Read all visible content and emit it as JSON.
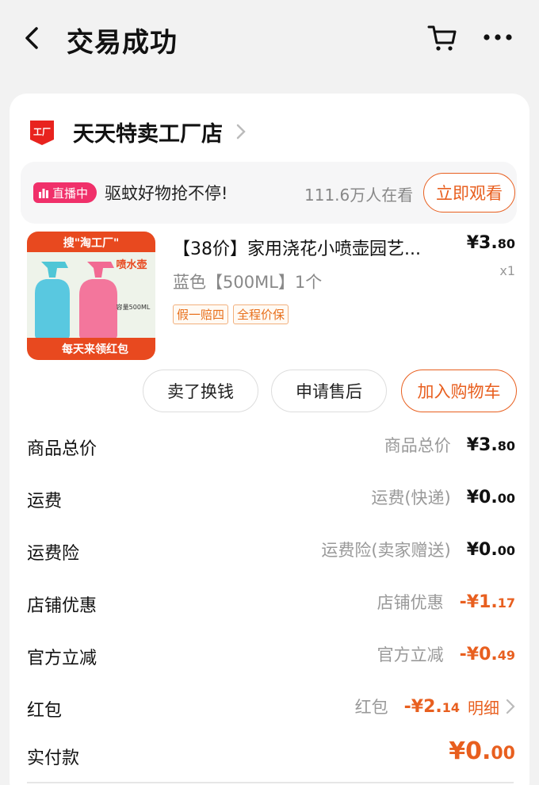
{
  "header": {
    "title": "交易成功"
  },
  "shop": {
    "name": "天天特卖工厂店",
    "logo_text": "工厂"
  },
  "live": {
    "badge": "直播中",
    "text": "驱蚊好物抢不停!",
    "count": "111.6万人在看",
    "button": "立即观看"
  },
  "product": {
    "image_banner_top": "搜\"淘工厂\"",
    "image_label": "喷水壶",
    "image_capacity": "容量500ML",
    "image_banner_bottom": "每天来领红包",
    "name": "【38价】家用浇花小喷壶园艺...",
    "price_int": "¥3.",
    "price_dec": "80",
    "qty": "x1",
    "sku": "蓝色【500ML】1个",
    "tags": [
      "假一赔四",
      "全程价保"
    ]
  },
  "actions": {
    "sell": "卖了换钱",
    "aftersale": "申请售后",
    "add_cart": "加入购物车"
  },
  "summary": [
    {
      "label": "商品总价",
      "desc": "商品总价",
      "amt_int": "¥3.",
      "amt_dec": "80",
      "negative": false
    },
    {
      "label": "运费",
      "desc": "运费(快递)",
      "amt_int": "¥0.",
      "amt_dec": "00",
      "negative": false
    },
    {
      "label": "运费险",
      "desc": "运费险(卖家赠送)",
      "amt_int": "¥0.",
      "amt_dec": "00",
      "negative": false
    },
    {
      "label": "店铺优惠",
      "desc": "店铺优惠",
      "amt_int": "-¥1.",
      "amt_dec": "17",
      "negative": true
    },
    {
      "label": "官方立减",
      "desc": "官方立减",
      "amt_int": "-¥0.",
      "amt_dec": "49",
      "negative": true
    }
  ],
  "redpack": {
    "label": "红包",
    "desc": "红包",
    "amt_int": "-¥2.",
    "amt_dec": "14",
    "detail": "明细"
  },
  "payment": {
    "label": "实付款",
    "amt_int": "¥0.",
    "amt_dec": "00"
  },
  "colors": {
    "accent": "#e85f1f",
    "live_pink": "#f0306a",
    "shop_red": "#e8231e"
  }
}
